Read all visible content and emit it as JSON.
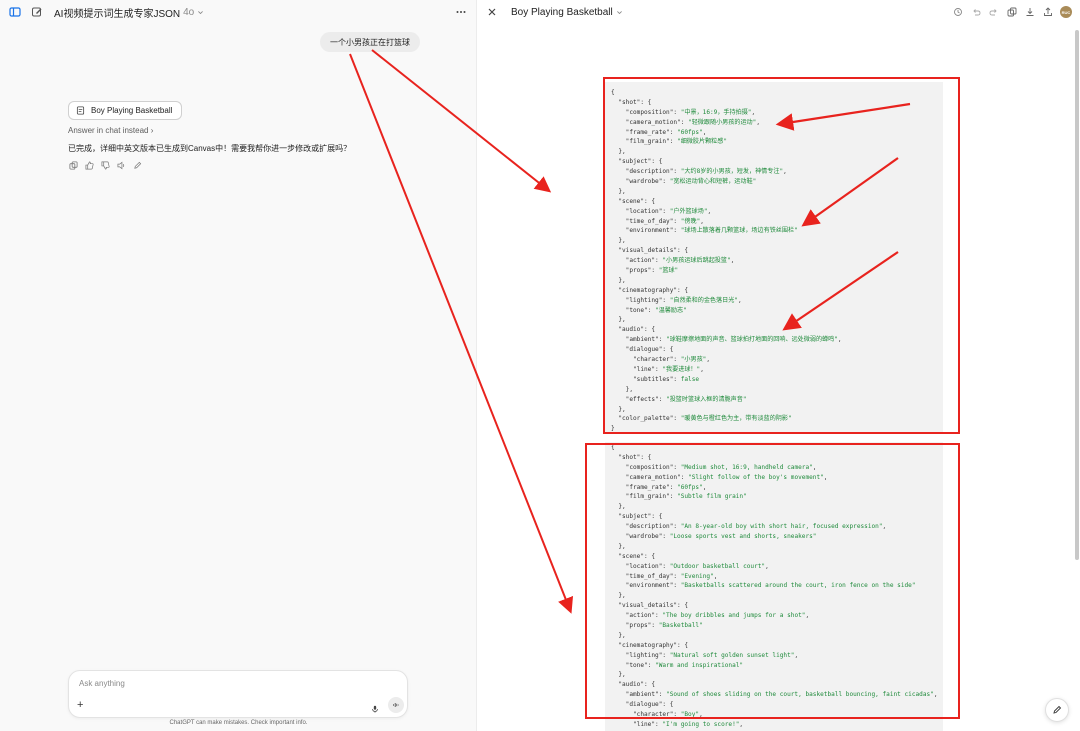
{
  "left_header": {
    "title": "AI视频提示词生成专家JSON",
    "model": "4o"
  },
  "chat": {
    "user_message": "一个小男孩正在打篮球",
    "canvas_chip_label": "Boy Playing Basketball",
    "answer_in_chat": "Answer in chat instead",
    "assistant_message": "已完成，详细中英文版本已生成到Canvas中！需要我帮你进一步修改或扩展吗？"
  },
  "composer": {
    "placeholder": "Ask anything",
    "disclaimer": "ChatGPT can make mistakes. Check important info."
  },
  "canvas": {
    "title": "Boy Playing Basketball",
    "avatar_text": "RUC"
  },
  "code_cn": [
    "{",
    "  \"shot\": {",
    "    \"composition\": \"中景，16:9，手持拍摄\",",
    "    \"camera_motion\": \"轻微跟随小男孩的运动\",",
    "    \"frame_rate\": \"60fps\",",
    "    \"film_grain\": \"细微胶片颗粒感\"",
    "  },",
    "  \"subject\": {",
    "    \"description\": \"大约8岁的小男孩，短发，神情专注\",",
    "    \"wardrobe\": \"宽松运动背心和短裤，运动鞋\"",
    "  },",
    "  \"scene\": {",
    "    \"location\": \"户外篮球场\",",
    "    \"time_of_day\": \"傍晚\",",
    "    \"environment\": \"球场上散落着几颗篮球，场边有铁丝围栏\"",
    "  },",
    "  \"visual_details\": {",
    "    \"action\": \"小男孩运球后跳起投篮\",",
    "    \"props\": \"篮球\"",
    "  },",
    "  \"cinematography\": {",
    "    \"lighting\": \"自然柔和的金色落日光\",",
    "    \"tone\": \"温馨励志\"",
    "  },",
    "  \"audio\": {",
    "    \"ambient\": \"球鞋摩擦地面的声音、篮球拍打地面的回响、远处微弱的蝉鸣\",",
    "    \"dialogue\": {",
    "      \"character\": \"小男孩\",",
    "      \"line\": \"我要进球！\",",
    "      \"subtitles\": false",
    "    },",
    "    \"effects\": \"投篮时篮球入框的清脆声音\"",
    "  },",
    "  \"color_palette\": \"暖黄色与橙红色为主，带有淡蓝的阴影\"",
    "}"
  ],
  "code_en": [
    "{",
    "  \"shot\": {",
    "    \"composition\": \"Medium shot, 16:9, handheld camera\",",
    "    \"camera_motion\": \"Slight follow of the boy's movement\",",
    "    \"frame_rate\": \"60fps\",",
    "    \"film_grain\": \"Subtle film grain\"",
    "  },",
    "  \"subject\": {",
    "    \"description\": \"An 8-year-old boy with short hair, focused expression\",",
    "    \"wardrobe\": \"Loose sports vest and shorts, sneakers\"",
    "  },",
    "  \"scene\": {",
    "    \"location\": \"Outdoor basketball court\",",
    "    \"time_of_day\": \"Evening\",",
    "    \"environment\": \"Basketballs scattered around the court, iron fence on the side\"",
    "  },",
    "  \"visual_details\": {",
    "    \"action\": \"The boy dribbles and jumps for a shot\",",
    "    \"props\": \"Basketball\"",
    "  },",
    "  \"cinematography\": {",
    "    \"lighting\": \"Natural soft golden sunset light\",",
    "    \"tone\": \"Warm and inspirational\"",
    "  },",
    "  \"audio\": {",
    "    \"ambient\": \"Sound of shoes sliding on the court, basketball bouncing, faint cicadas\",",
    "    \"dialogue\": {",
    "      \"character\": \"Boy\",",
    "      \"line\": \"I'm going to score!\","
  ],
  "icons": {
    "sidebar": "sidebar-icon",
    "new_chat": "compose-icon",
    "more": "more-icon",
    "close": "close-icon",
    "history": "history-icon",
    "undo": "undo-icon",
    "redo": "redo-icon",
    "copy": "copy-icon",
    "download": "download-icon",
    "share": "share-icon"
  },
  "colors": {
    "annotation": "#e8231e",
    "json_string": "#1f8a3b"
  }
}
